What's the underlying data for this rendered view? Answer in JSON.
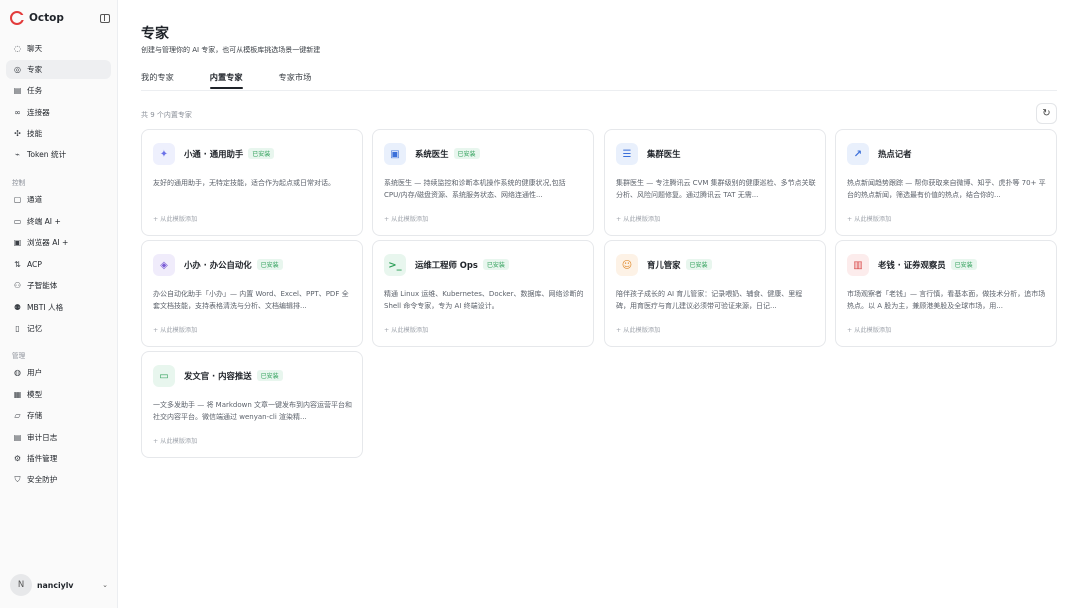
{
  "app": {
    "name": "Octop"
  },
  "sidebar": {
    "top_items": [
      {
        "label": "聊天",
        "icon": "chat-icon"
      },
      {
        "label": "专家",
        "icon": "expert-icon"
      },
      {
        "label": "任务",
        "icon": "task-icon"
      },
      {
        "label": "连接器",
        "icon": "link-icon"
      },
      {
        "label": "技能",
        "icon": "skill-icon"
      },
      {
        "label": "Token 统计",
        "icon": "stats-icon"
      }
    ],
    "control_label": "控制",
    "control_items": [
      {
        "label": "通道",
        "icon": "channel-icon"
      },
      {
        "label": "终端 AI +",
        "icon": "terminal-icon"
      },
      {
        "label": "浏览器 AI +",
        "icon": "browser-icon"
      },
      {
        "label": "ACP",
        "icon": "acp-icon"
      },
      {
        "label": "子智能体",
        "icon": "subagent-icon"
      },
      {
        "label": "MBTI 人格",
        "icon": "mbti-icon"
      },
      {
        "label": "记忆",
        "icon": "memory-icon"
      }
    ],
    "manage_label": "管理",
    "manage_items": [
      {
        "label": "用户",
        "icon": "user-icon"
      },
      {
        "label": "模型",
        "icon": "model-icon"
      },
      {
        "label": "存储",
        "icon": "storage-icon"
      },
      {
        "label": "审计日志",
        "icon": "audit-icon"
      },
      {
        "label": "插件管理",
        "icon": "plugin-icon"
      },
      {
        "label": "安全防护",
        "icon": "shield-icon"
      }
    ],
    "user": {
      "initial": "N",
      "name": "nanciylv"
    }
  },
  "main": {
    "title": "专家",
    "subtitle": "创建与管理你的 AI 专家，也可从模板库挑选场景一键新建",
    "tabs": [
      "我的专家",
      "内置专家",
      "专家市场"
    ],
    "count_label": "共 9 个内置专家",
    "cards": [
      {
        "title": "小通 · 通用助手",
        "badge": "已安装",
        "desc": "友好的通用助手，无特定技能，适合作为起点或日常对话。",
        "source": "+ 从此模版添加",
        "icon": "sparkle-icon",
        "glyph": "✦",
        "color": "#6b72e8",
        "bg": "#eef0fd"
      },
      {
        "title": "系统医生",
        "badge": "已安装",
        "desc": "系统医生 — 持续监控和诊断本机操作系统的健康状况,包括 CPU/内存/磁盘资源、系统服务状态、网络连通性...",
        "source": "+ 从此模版添加",
        "icon": "chip-icon",
        "glyph": "▣",
        "color": "#3b6fd9",
        "bg": "#e9f0fc"
      },
      {
        "title": "集群医生",
        "badge": "",
        "desc": "集群医生 — 专注腾讯云 CVM 集群级别的健康巡检、多节点关联分析、风险问题修复。通过腾讯云 TAT 无需...",
        "source": "+ 从此模版添加",
        "icon": "server-icon",
        "glyph": "☰",
        "color": "#3b6fd9",
        "bg": "#e9f0fc"
      },
      {
        "title": "热点记者",
        "badge": "",
        "desc": "热点新闻趋势跟踪 — 帮你获取来自微博、知乎、虎扑等 70+ 平台的热点新闻，筛选最有价值的热点，结合你的...",
        "source": "+ 从此模版添加",
        "icon": "trending-icon",
        "glyph": "↗",
        "color": "#3b6fd9",
        "bg": "#e9f0fc"
      },
      {
        "title": "小办 · 办公自动化",
        "badge": "已安装",
        "desc": "办公自动化助手「小办」— 内置 Word、Excel、PPT、PDF 全套文档技能，支持表格清洗与分析、文档编辑排...",
        "source": "+ 从此模版添加",
        "icon": "layers-icon",
        "glyph": "◈",
        "color": "#7a5cd6",
        "bg": "#f0ecfb"
      },
      {
        "title": "运维工程师 Ops",
        "badge": "已安装",
        "desc": "精通 Linux 运维、Kubernetes、Docker、数据库、网络诊断的 Shell 命令专家，专为 AI 终端设计。",
        "source": "+ 从此模版添加",
        "icon": "terminal-prompt-icon",
        "glyph": ">_",
        "color": "#2fa05a",
        "bg": "#e8f6ee"
      },
      {
        "title": "育儿管家",
        "badge": "已安装",
        "desc": "陪伴孩子成长的 AI 育儿管家：记录喂奶、辅食、健康、里程碑，用育医疗与育儿建议必须带可验证来源，日记...",
        "source": "+ 从此模版添加",
        "icon": "smile-icon",
        "glyph": "☺",
        "color": "#e08a2c",
        "bg": "#fdf2e6"
      },
      {
        "title": "老钱 · 证券观察员",
        "badge": "已安装",
        "desc": "市场观察者「老钱」— 言行慎，看基本面，做技术分析，追市场热点。以 A 股为主，兼顾港美股及全球市场，用...",
        "source": "+ 从此模版添加",
        "icon": "chart-icon",
        "glyph": "▥",
        "color": "#d94848",
        "bg": "#fcecec"
      },
      {
        "title": "发文官 · 内容推送",
        "badge": "已安装",
        "desc": "一文多发助手 — 将 Markdown 文章一键发布到内容运营平台和社交内容平台。微信端通过 wenyan-cli 渲染精...",
        "source": "+ 从此模版添加",
        "icon": "message-icon",
        "glyph": "▭",
        "color": "#2fa05a",
        "bg": "#e8f6ee"
      }
    ]
  }
}
